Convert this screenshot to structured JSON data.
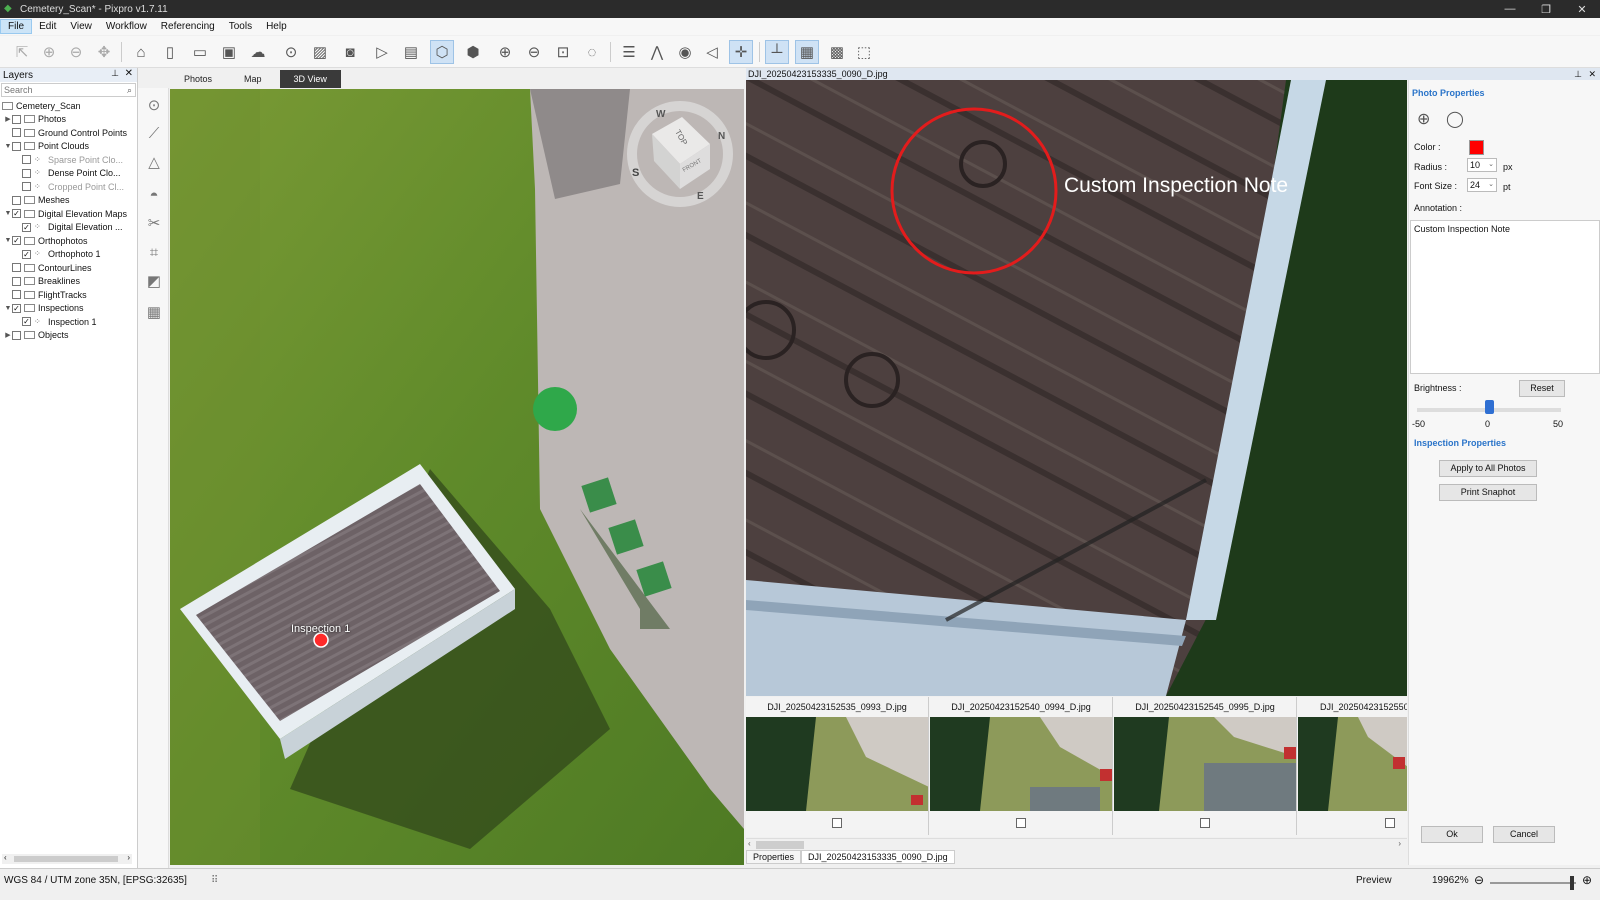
{
  "window": {
    "title": "Cemetery_Scan* - Pixpro v1.7.11"
  },
  "menu": [
    "File",
    "Edit",
    "View",
    "Workflow",
    "Referencing",
    "Tools",
    "Help"
  ],
  "layers": {
    "title": "Layers",
    "search_placeholder": "Search",
    "root": "Cemetery_Scan",
    "items": [
      {
        "label": "Photos",
        "level": 1,
        "expander": "right",
        "checked": false
      },
      {
        "label": "Ground Control Points",
        "level": 1,
        "expander": "",
        "checked": false
      },
      {
        "label": "Point Clouds",
        "level": 1,
        "expander": "down",
        "checked": false
      },
      {
        "label": "Sparse Point Clo...",
        "level": 2,
        "expander": "",
        "checked": false,
        "grey": true
      },
      {
        "label": "Dense Point Clo...",
        "level": 2,
        "expander": "",
        "checked": false
      },
      {
        "label": "Cropped Point Cl...",
        "level": 2,
        "expander": "",
        "checked": false,
        "grey": true
      },
      {
        "label": "Meshes",
        "level": 1,
        "expander": "",
        "checked": false
      },
      {
        "label": "Digital Elevation Maps",
        "level": 1,
        "expander": "down",
        "checked": true
      },
      {
        "label": "Digital Elevation ...",
        "level": 2,
        "expander": "",
        "checked": true
      },
      {
        "label": "Orthophotos",
        "level": 1,
        "expander": "down",
        "checked": true
      },
      {
        "label": "Orthophoto 1",
        "level": 2,
        "expander": "",
        "checked": true
      },
      {
        "label": "ContourLines",
        "level": 1,
        "expander": "",
        "checked": false
      },
      {
        "label": "Breaklines",
        "level": 1,
        "expander": "",
        "checked": false
      },
      {
        "label": "FlightTracks",
        "level": 1,
        "expander": "",
        "checked": false
      },
      {
        "label": "Inspections",
        "level": 1,
        "expander": "down",
        "checked": true
      },
      {
        "label": "Inspection 1",
        "level": 2,
        "expander": "",
        "checked": true
      },
      {
        "label": "Objects",
        "level": 1,
        "expander": "right",
        "checked": false
      }
    ]
  },
  "view_tabs": [
    "Photos",
    "Map",
    "3D View"
  ],
  "view3d": {
    "marker_label": "Inspection 1",
    "compass": {
      "n": "N",
      "s": "S",
      "e": "E",
      "w": "W",
      "top": "TOP",
      "front": "FRONT"
    }
  },
  "photo": {
    "filename": "DJI_20250423153335_0090_D.jpg",
    "annotation_text": "Custom Inspection Note"
  },
  "thumbnails": [
    {
      "name": "DJI_20250423152535_0993_D.jpg"
    },
    {
      "name": "DJI_20250423152540_0994_D.jpg"
    },
    {
      "name": "DJI_20250423152545_0995_D.jpg"
    },
    {
      "name": "DJI_20250423152550"
    }
  ],
  "bottom_tabs": [
    "Properties",
    "DJI_20250423153335_0090_D.jpg"
  ],
  "props": {
    "photo_header": "Photo Properties",
    "color_label": "Color :",
    "color_value": "#ff0000",
    "radius_label": "Radius :",
    "radius_value": "10",
    "radius_unit": "px",
    "font_label": "Font Size :",
    "font_value": "24",
    "font_unit": "pt",
    "annotation_label": "Annotation :",
    "annotation_value": "Custom Inspection Note",
    "brightness_label": "Brightness :",
    "reset": "Reset",
    "bmin": "-50",
    "bmid": "0",
    "bmax": "50",
    "brightness_value": 0,
    "inspection_header": "Inspection Properties",
    "apply_all": "Apply to All Photos",
    "print_snapshot": "Print Snaphot",
    "ok": "Ok",
    "cancel": "Cancel"
  },
  "status": {
    "crs": "WGS 84 / UTM zone 35N, [EPSG:32635]",
    "preview": "Preview",
    "zoom": "19962%"
  }
}
